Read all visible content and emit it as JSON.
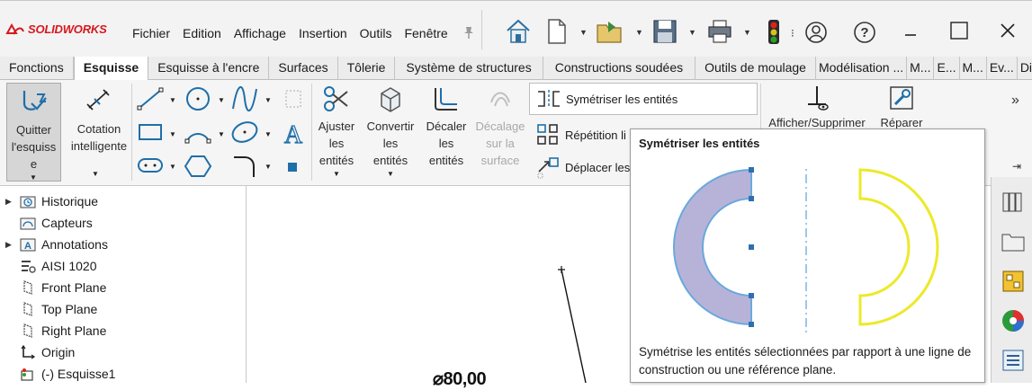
{
  "app": {
    "logo_text": "SOLIDWORKS",
    "brand_color": "#d7181f"
  },
  "menu": {
    "items": [
      "Fichier",
      "Edition",
      "Affichage",
      "Insertion",
      "Outils",
      "Fenêtre"
    ]
  },
  "titlebar_icons": [
    "home-icon",
    "new-document-icon",
    "open-folder-icon",
    "save-icon",
    "print-icon",
    "rebuild-traffic-light-icon",
    "user-icon",
    "help-icon",
    "minimize-icon",
    "maximize-icon",
    "close-icon"
  ],
  "tabs": [
    {
      "label": "Fonctions",
      "active": false
    },
    {
      "label": "Esquisse",
      "active": true
    },
    {
      "label": "Esquisse à l'encre",
      "active": false
    },
    {
      "label": "Surfaces",
      "active": false
    },
    {
      "label": "Tôlerie",
      "active": false
    },
    {
      "label": "Système de structures",
      "active": false
    },
    {
      "label": "Constructions soudées",
      "active": false
    },
    {
      "label": "Outils de moulage",
      "active": false
    },
    {
      "label": "Modélisation ...",
      "active": false
    },
    {
      "label": "M...",
      "active": false
    },
    {
      "label": "E...",
      "active": false
    },
    {
      "label": "M...",
      "active": false
    },
    {
      "label": "Ev...",
      "active": false
    },
    {
      "label": "Di...",
      "active": false
    }
  ],
  "ribbon": {
    "quitter": {
      "line1": "Quitter",
      "line2": "l'esquiss",
      "line3": "e"
    },
    "cotation": {
      "line1": "Cotation",
      "line2": "intelligente"
    },
    "ajuster": {
      "line1": "Ajuster",
      "line2": "les",
      "line3": "entités"
    },
    "convertir": {
      "line1": "Convertir",
      "line2": "les",
      "line3": "entités"
    },
    "decaler": {
      "line1": "Décaler",
      "line2": "les",
      "line3": "entités"
    },
    "decalage": {
      "line1": "Décalage",
      "line2": "sur la",
      "line3": "surface"
    },
    "symetriser": "Symétriser les entités",
    "repetition": "Répétition li",
    "deplacer": "Déplacer les",
    "afficher": "Afficher/Supprimer",
    "reparer": "Réparer"
  },
  "tooltip": {
    "title": "Symétriser les entités",
    "description": "Symétrise les entités sélectionnées par rapport à une ligne de construction ou une référence plane."
  },
  "tree": {
    "items": [
      {
        "label": "Historique",
        "icon": "history-folder-icon",
        "expandable": true
      },
      {
        "label": "Capteurs",
        "icon": "sensors-icon",
        "expandable": false
      },
      {
        "label": "Annotations",
        "icon": "annotations-icon",
        "expandable": true
      },
      {
        "label": "AISI 1020",
        "icon": "material-icon",
        "expandable": false
      },
      {
        "label": "Front Plane",
        "icon": "plane-icon",
        "expandable": false
      },
      {
        "label": "Top Plane",
        "icon": "plane-icon",
        "expandable": false
      },
      {
        "label": "Right Plane",
        "icon": "plane-icon",
        "expandable": false
      },
      {
        "label": "Origin",
        "icon": "origin-icon",
        "expandable": false
      },
      {
        "label": "(-) Esquisse1",
        "icon": "sketch-icon",
        "expandable": false
      }
    ]
  },
  "graphics": {
    "dimension": "⌀80,00"
  },
  "taskpane_icons": [
    "design-library-icon",
    "file-explorer-icon",
    "view-palette-icon",
    "appearances-icon",
    "custom-properties-icon"
  ]
}
